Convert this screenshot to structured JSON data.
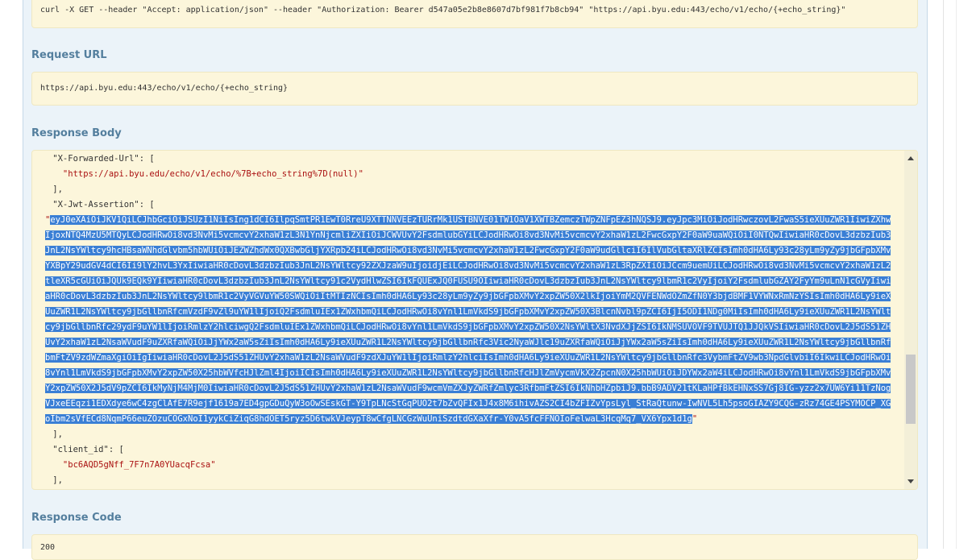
{
  "curl": {
    "command": "curl -X GET --header \"Accept: application/json\" --header \"Authorization: Bearer d547a05e2b8e8607d7bf981f7b8cb94\" \"https://api.byu.edu:443/echo/v1/echo/{+echo_string}\""
  },
  "request_url": {
    "heading": "Request URL",
    "value": "https://api.byu.edu:443/echo/v1/echo/{+echo_string}"
  },
  "response_body": {
    "heading": "Response Body",
    "lines": [
      "    \"X-Forwarded-Url\": [",
      "      \"https://api.byu.edu/echo/v1/echo/%7B+echo_string%7D(null)\"",
      "    ],",
      "    \"X-Jwt-Assertion\": ["
    ],
    "jwt_quote_open": "      \"",
    "jwt_token": "eyJ0eXAiOiJKV1QiLCJhbGciOiJSUzI1NiIsIng1dCI6IlpqSmtPR1EwT0RreU9XTTNNVEEzTURrMk1USTBNVE01TW1OaV1XWTBZemczTWpZNFpEZ3hNQSJ9.eyJpc3MiOiJodHRwczovL2FwaS5ieXUuZWR1IiwiZXhwIjoxNTQ4MzU5MTQyLCJodHRwOi8vd3NvMi5vcmcvY2xhaW1zL3N1YnNjcmliZXIiOiJCWVUvY2FsdmlubGYiLCJodHRwOi8vd3NvMi5vcmcvY2xhaW1zL2FwcGxpY2F0aW9uaWQiOiI0NTQwIiwiaHR0cDovL3dzbzIub3JnL2NsYWltcy9hcHBsaWNhdGlvbm5hbWUiOiJEZWZhdWx0QXBwbGljYXRpb24iLCJodHRwOi8vd3NvMi5vcmcvY2xhaW1zL2FwcGxpY2F0aW9udGllciI6IlVubGltaXRlZCIsImh0dHA6Ly93c28yLm9yZy9jbGFpbXMvYXBpY29udGV4dCI6Ii9lY2hvL3YxIiwiaHR0cDovL3dzbzIub3JnL2NsYWltcy92ZXJzaW9uIjoidjEiLCJodHRwOi8vd3NvMi5vcmcvY2xhaW1zL3RpZXIiOiJCcm9uemUiLCJodHRwOi8vd3NvMi5vcmcvY2xhaW1zL2tleXR5cGUiOiJQUk9EQk9YIiwiaHR0cDovL3dzbzIub3JnL2NsYWltcy91c2VydHlwZSI6IkFQUExJQ0FUSU9OIiwiaHR0cDovL3dzbzIub3JnL2NsYWltcy9lbmR1c2VyIjoiY2FsdmlubGZAY2FyYm9uLnN1cGVyIiwiaHR0cDovL3dzbzIub3JnL2NsYWltcy9lbmR1c2VyVGVuYW50SWQiOiItMTIzNCIsImh0dHA6Ly93c28yLm9yZy9jbGFpbXMvY2xpZW50X2lkIjoiYmM2QVFENWdOZmZfN0Y3bjdBMF1VYWNxRmNzYSIsImh0dHA6Ly9ieXUuZWR1L2NsYWltcy9jbGllbnRfcmVzdF9vZl9uYW1lIjoiQ2FsdmluIEx1ZWxhbmQiLCJodHRwOi8vYnl1LmVkdS9jbGFpbXMvY2xpZW50X3BlcnNvbl9pZCI6IjI5ODI1NDg0MiIsImh0dHA6Ly9ieXUuZWR1L2NsYWltcy9jbGllbnRfc29ydF9uYW1lIjoiRmlzY2hlciwgQ2FsdmluIEx1ZWxhbmQiLCJodHRwOi8vYnl1LmVkdS9jbGFpbXMvY2xpZW50X2NsYWltX3NvdXJjZSI6IkNMSUVOVF9TVUJTQ1JJQkVSIiwiaHR0cDovL2J5dS51ZHUvY2xhaW1zL2NsaWVudF9uZXRfaWQiOiJjYWx2aW5sZiIsImh0dHA6Ly9ieXUuZWR1L2NsYWltcy9jbGllbnRfc3Vic2NyaWJlc19uZXRfaWQiOiJjYWx2aW5sZiIsImh0dHA6Ly9ieXUuZWR1L2NsYWltcy9jbGllbnRfbmFtZV9zdWZmaXgiOiIgIiwiaHR0cDovL2J5dS51ZHUvY2xhaW1zL2NsaWVudF9zdXJuYW1lIjoiRmlzY2hlciIsImh0dHA6Ly9ieXUuZWR1L2NsYWltcy9jbGllbnRfc3VybmFtZV9wb3NpdGlvbiI6IkwiLCJodHRwOi8vYnl1LmVkdS9jbGFpbXMvY2xpZW50X25hbWVfcHJlZml4IjoiICIsImh0dHA6Ly9ieXUuZWR1L2NsYWltcy9jbGllbnRfcHJlZmVycmVkX2ZpcnN0X25hbWUiOiJDYWx2aW4iLCJodHRwOi8vYnl1LmVkdS9jbGFpbXMvY2xpZW50X2J5dV9pZCI6IkMyNjM4MjM0IiwiaHR0cDovL2J5dS51ZHUvY2xhaW1zL2NsaWVudF9wcmVmZXJyZWRfZmlyc3RfbmFtZSI6IkNhbHZpbiJ9.bbB9ADV21tKLaHPfBkEHNxSS7Gj8IG-yzz2x7UW6Yi11TzNogVJxeEEqzi1EDXdye6wC4zgClAfE7R9ejf1619a7ED4gpGDuQyW3oOwSEskGT-Y9TpLNcStGqPUO2t7bZvQFIx1J4x8M6ihivAZS2CI4bZFIZvYpsLyl_StRaQtunw-IwNVL5Lh5psoGIAZY9CQG-zRz74GE4PSYMOCP_XGoIbm2sVfECd8NqmP66euZOzuCOGxNoI1yykCiZiqG8hdOET5ryz5D6twkVJeypT8wCfgLNCGzWuUniSzdtdGXaXfr-Y0vA5fcFFNOIoFelwaL3HcqMq7_VX6Ypx1d1g",
    "jwt_quote_close": "\"",
    "after_lines": [
      "    ],",
      "    \"client_id\": [",
      "      \"bc6AQD5gNff_7F7n7A0YUacqFcsa\"",
      "    ],"
    ]
  },
  "response_code": {
    "heading": "Response Code",
    "value": "200"
  }
}
